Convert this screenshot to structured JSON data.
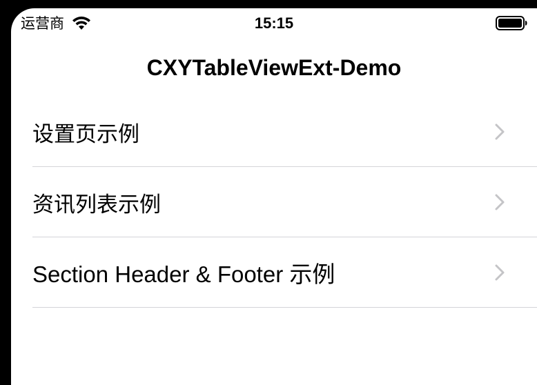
{
  "status_bar": {
    "carrier": "运营商",
    "time": "15:15",
    "icons": [
      "wifi-icon",
      "battery-icon"
    ]
  },
  "nav_bar": {
    "title": "CXYTableViewExt-Demo"
  },
  "table": {
    "rows": [
      {
        "label": "设置页示例",
        "accessory": "chevron-right-icon"
      },
      {
        "label": "资讯列表示例",
        "accessory": "chevron-right-icon"
      },
      {
        "label": "Section Header & Footer 示例",
        "accessory": "chevron-right-icon"
      }
    ]
  },
  "colors": {
    "background": "#ffffff",
    "bezel": "#000000",
    "text": "#000000",
    "chevron": "#c4c4c7",
    "separator": "#d4d4d8"
  }
}
